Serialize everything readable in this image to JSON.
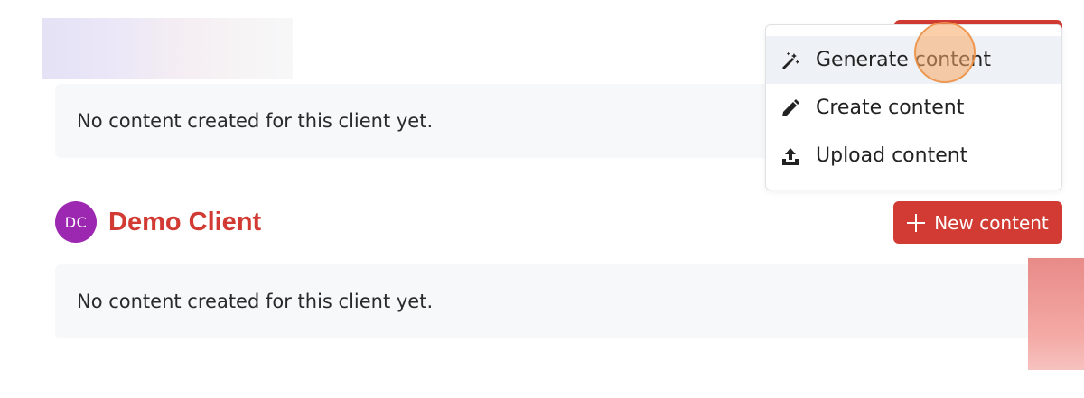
{
  "clients": [
    {
      "empty_text": "No content created for this client yet."
    },
    {
      "initials": "DC",
      "name": "Demo Client",
      "new_content_label": "New content",
      "empty_text": "No content created for this client yet."
    }
  ],
  "dropdown": {
    "items": [
      {
        "label": "Generate content",
        "icon": "magic-wand-icon",
        "active": true
      },
      {
        "label": "Create content",
        "icon": "pencil-icon",
        "active": false
      },
      {
        "label": "Upload content",
        "icon": "upload-icon",
        "active": false
      }
    ]
  },
  "colors": {
    "accent": "#d13b33",
    "avatar": "#9c27b0",
    "panel_bg": "#f7f8fa",
    "menu_active_bg": "#eef1f5",
    "cursor_highlight": "#f7a864"
  }
}
